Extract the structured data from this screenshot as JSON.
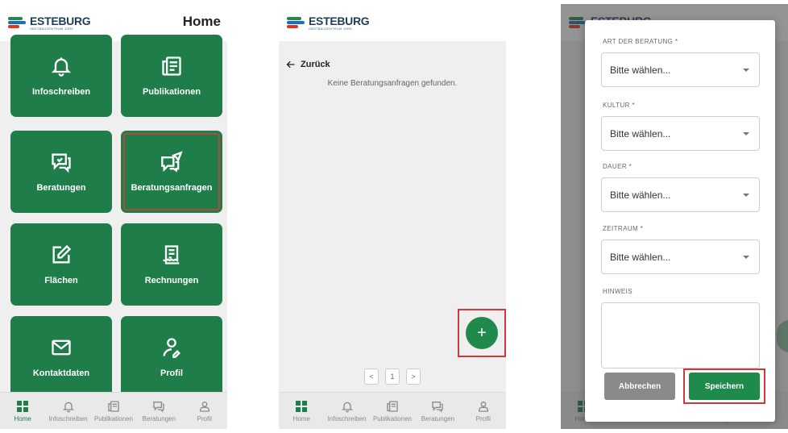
{
  "brand": {
    "name": "ESTEBURG",
    "subtitle": "OBSTBAUZENTRUM JORK"
  },
  "screen1": {
    "title": "Home",
    "tiles": [
      {
        "label": "Infoschreiben",
        "icon": "bell-icon"
      },
      {
        "label": "Publikationen",
        "icon": "newspaper-icon"
      },
      {
        "label": "Beratungen",
        "icon": "chat-icon"
      },
      {
        "label": "Beratungsanfragen",
        "icon": "chat-send-icon",
        "selected": true
      },
      {
        "label": "Flächen",
        "icon": "edit-icon"
      },
      {
        "label": "Rechnungen",
        "icon": "receipt-icon"
      },
      {
        "label": "Kontaktdaten",
        "icon": "mail-icon"
      },
      {
        "label": "Profil",
        "icon": "user-icon"
      }
    ]
  },
  "screen2": {
    "back_label": "Zurück",
    "empty_message": "Keine Beratungsanfragen gefunden.",
    "fab_label": "+",
    "pager": {
      "prev": "<",
      "current": "1",
      "next": ">"
    }
  },
  "screen3": {
    "fields": [
      {
        "label": "ART DER BERATUNG *",
        "placeholder": "Bitte wählen..."
      },
      {
        "label": "KULTUR *",
        "placeholder": "Bitte wählen..."
      },
      {
        "label": "DAUER *",
        "placeholder": "Bitte wählen..."
      },
      {
        "label": "ZEITRAUM *",
        "placeholder": "Bitte wählen..."
      }
    ],
    "hint_label": "HINWEIS",
    "cancel_label": "Abbrechen",
    "save_label": "Speichern"
  },
  "nav": [
    {
      "label": "Home",
      "icon": "dashboard-icon"
    },
    {
      "label": "Infoschreiben",
      "icon": "bell-icon"
    },
    {
      "label": "Publikationen",
      "icon": "newspaper-icon"
    },
    {
      "label": "Beratungen",
      "icon": "chat-icon"
    },
    {
      "label": "Profil",
      "icon": "user-icon"
    }
  ],
  "colors": {
    "primary": "#1e7d48",
    "highlight": "#d2383a"
  }
}
